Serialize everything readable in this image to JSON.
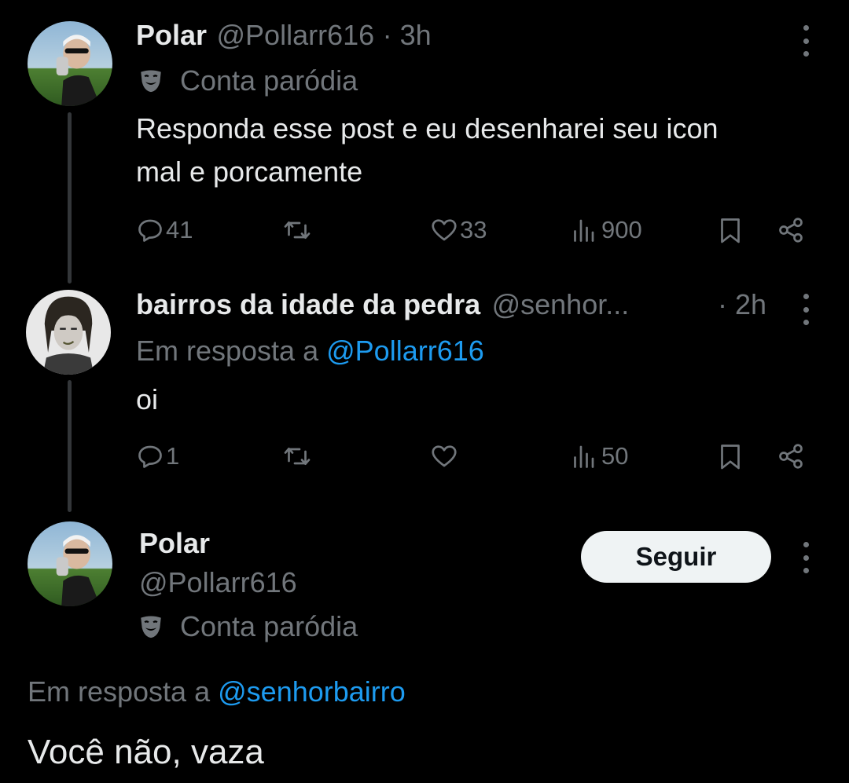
{
  "tweets": [
    {
      "name": "Polar",
      "handle": "@Pollarr616",
      "time": "· 3h",
      "badge": "Conta paródia",
      "text_line1": "Responda esse post e eu desenharei seu icon",
      "text_line2": "mal e porcamente",
      "replies": "41",
      "retweets": "",
      "likes": "33",
      "views": "900"
    },
    {
      "name": "bairros da idade da pedra",
      "handle": "@senhor...",
      "time": "· 2h",
      "reply_prefix": "Em resposta a",
      "reply_to": "@Pollarr616",
      "text": "oi",
      "replies": "1",
      "retweets": "",
      "likes": "",
      "views": "50"
    }
  ],
  "focused": {
    "name": "Polar",
    "handle": "@Pollarr616",
    "badge": "Conta paródia",
    "follow_label": "Seguir",
    "reply_prefix": "Em resposta a",
    "reply_to": "@senhorbairro",
    "text": "Você não, vaza"
  },
  "icons": {
    "reply": "reply-icon",
    "retweet": "retweet-icon",
    "like": "heart-icon",
    "views": "views-icon",
    "bookmark": "bookmark-icon",
    "share": "share-icon",
    "more": "more-icon",
    "parody": "parody-mask-icon"
  },
  "colors": {
    "background": "#000000",
    "text": "#e7e9ea",
    "muted": "#71767b",
    "link": "#1d9bf0",
    "thread_line": "#333639",
    "follow_bg": "#eff3f4"
  }
}
